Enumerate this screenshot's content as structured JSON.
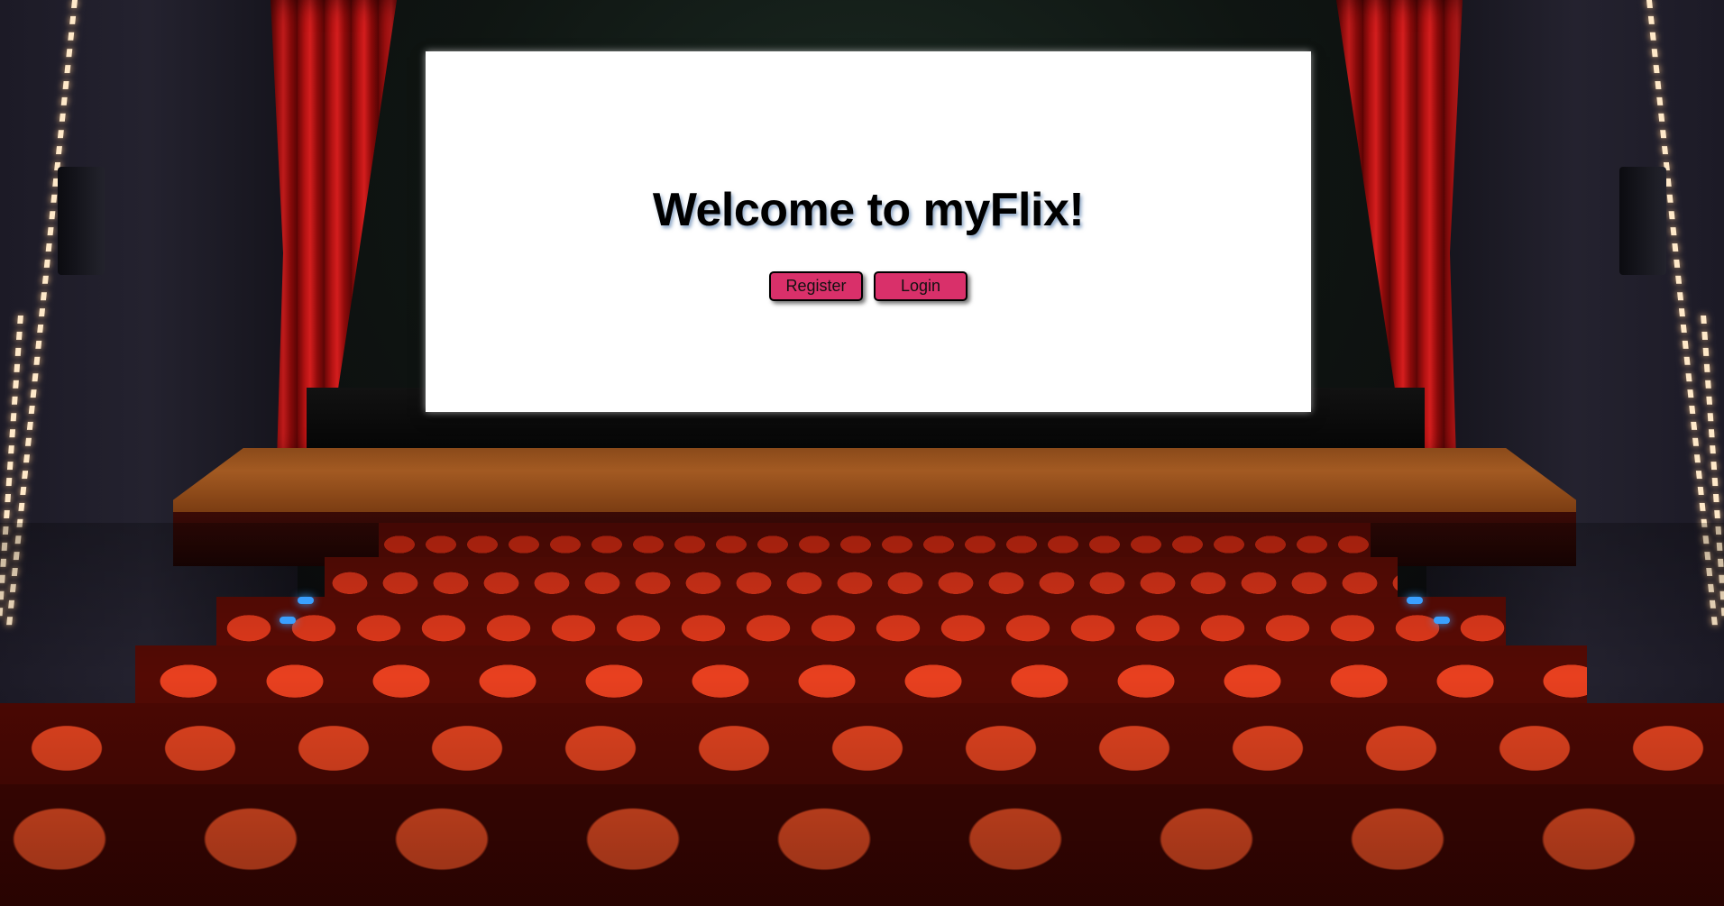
{
  "welcome": {
    "title": "Welcome to myFlix!",
    "register_label": "Register",
    "login_label": "Login"
  },
  "colors": {
    "button_bg": "#d9306a",
    "screen_bg": "#ffffff",
    "title_shadow": "#285a96"
  },
  "background": {
    "scene": "movie-theater-image"
  }
}
